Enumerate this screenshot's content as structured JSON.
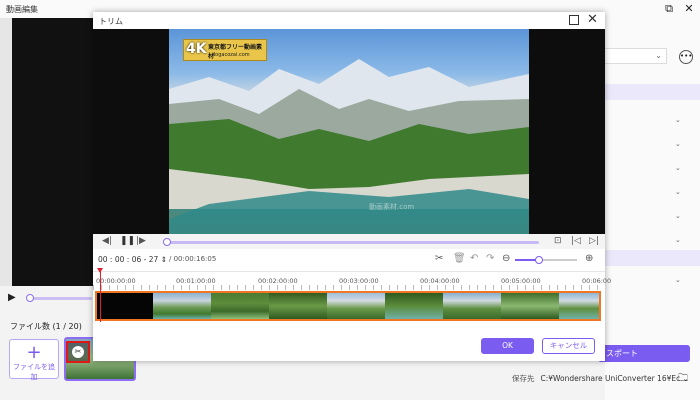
{
  "app": {
    "window_title": "動画編集"
  },
  "background": {
    "file_count": "ファイル数 (1 / 20)",
    "add_file_label": "ファイルを追加",
    "export_label": "スポート",
    "save_location_label": "保存先",
    "save_location_path": "C:¥Wondershare UniConverter 16¥Ec"
  },
  "dialog": {
    "title": "トリム",
    "timecode_hh": "00",
    "timecode_mm": "00",
    "timecode_ss": "06",
    "timecode_ff": "27",
    "duration": "/ 00:00:16:05",
    "ruler_labels": [
      "00:00:00:00",
      "00:01:00:00",
      "00:02:00:00",
      "00:03:00:00",
      "00:04:00:00",
      "00:05:00:00",
      "00:06:00"
    ],
    "ok_label": "OK",
    "cancel_label": "キャンセル",
    "video_logo_main": "4K",
    "video_logo_text": "東京都フリー動画素材",
    "video_logo_site": "dogacozai.com",
    "video_watermark": "動画素材.com"
  },
  "colors": {
    "accent": "#7b5cf0",
    "trim_border": "#f07623",
    "playhead": "#dd2233"
  }
}
